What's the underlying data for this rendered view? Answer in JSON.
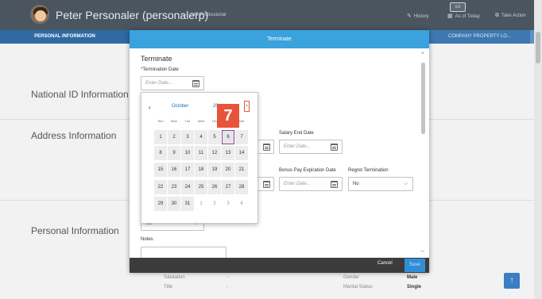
{
  "topbar": {
    "person_name": "Peter Personaler (personalerp)",
    "person_subtitle": "HR Professional",
    "actions": [
      {
        "icon": "pencil-icon",
        "label": "History"
      },
      {
        "icon": "calendar-icon",
        "label": "As of Today"
      },
      {
        "icon": "external-link-icon",
        "label": "Take Action"
      }
    ]
  },
  "tabs": {
    "left": "PERSONAL INFORMATION",
    "right": "COMPANY PROPERTY LO..."
  },
  "sections": [
    "National ID Information",
    "Address Information",
    "Personal Information"
  ],
  "bottom_fields": {
    "salutation_label": "Salutation",
    "salutation_value": "-",
    "title_label": "Title",
    "title_value": "-",
    "gender_label": "Gender",
    "gender_value": "Male",
    "marital_label": "Marital Status",
    "marital_value": "Single"
  },
  "modal": {
    "header": "Terminate",
    "title": "Terminate",
    "termination_date_label": "Termination Date",
    "date_placeholder": "Enter Date...",
    "salary_end_label": "Salary End Date",
    "bonus_pay_label": "Bonus Pay Expiration Date",
    "regret_label": "Regret Termination",
    "regret_value": "No",
    "partial_value": "No",
    "notes_label": "Notes",
    "cancel": "Cancel",
    "save": "Save"
  },
  "calendar": {
    "month": "October",
    "year": "20",
    "weekdays": [
      "Sun",
      "Mon",
      "Tue",
      "Wed",
      "Thu",
      "Fri",
      "Sat"
    ],
    "selected_day": "6",
    "weeks": [
      [
        {
          "d": "1",
          "o": false
        },
        {
          "d": "2",
          "o": false
        },
        {
          "d": "3",
          "o": false
        },
        {
          "d": "4",
          "o": false
        },
        {
          "d": "5",
          "o": false
        },
        {
          "d": "6",
          "o": false
        },
        {
          "d": "7",
          "o": false
        }
      ],
      [
        {
          "d": "8",
          "o": false
        },
        {
          "d": "9",
          "o": false
        },
        {
          "d": "10",
          "o": false
        },
        {
          "d": "11",
          "o": false
        },
        {
          "d": "12",
          "o": false
        },
        {
          "d": "13",
          "o": false
        },
        {
          "d": "14",
          "o": false
        }
      ],
      [
        {
          "d": "15",
          "o": false
        },
        {
          "d": "16",
          "o": false
        },
        {
          "d": "17",
          "o": false
        },
        {
          "d": "18",
          "o": false
        },
        {
          "d": "19",
          "o": false
        },
        {
          "d": "20",
          "o": false
        },
        {
          "d": "21",
          "o": false
        }
      ],
      [
        {
          "d": "22",
          "o": false
        },
        {
          "d": "23",
          "o": false
        },
        {
          "d": "24",
          "o": false
        },
        {
          "d": "25",
          "o": false
        },
        {
          "d": "26",
          "o": false
        },
        {
          "d": "27",
          "o": false
        },
        {
          "d": "28",
          "o": false
        }
      ],
      [
        {
          "d": "29",
          "o": false
        },
        {
          "d": "30",
          "o": false
        },
        {
          "d": "31",
          "o": false
        },
        {
          "d": "1",
          "o": true
        },
        {
          "d": "2",
          "o": true
        },
        {
          "d": "3",
          "o": true
        },
        {
          "d": "4",
          "o": true
        }
      ]
    ]
  },
  "step_marker": "7",
  "scroll_top_glyph": "↑"
}
